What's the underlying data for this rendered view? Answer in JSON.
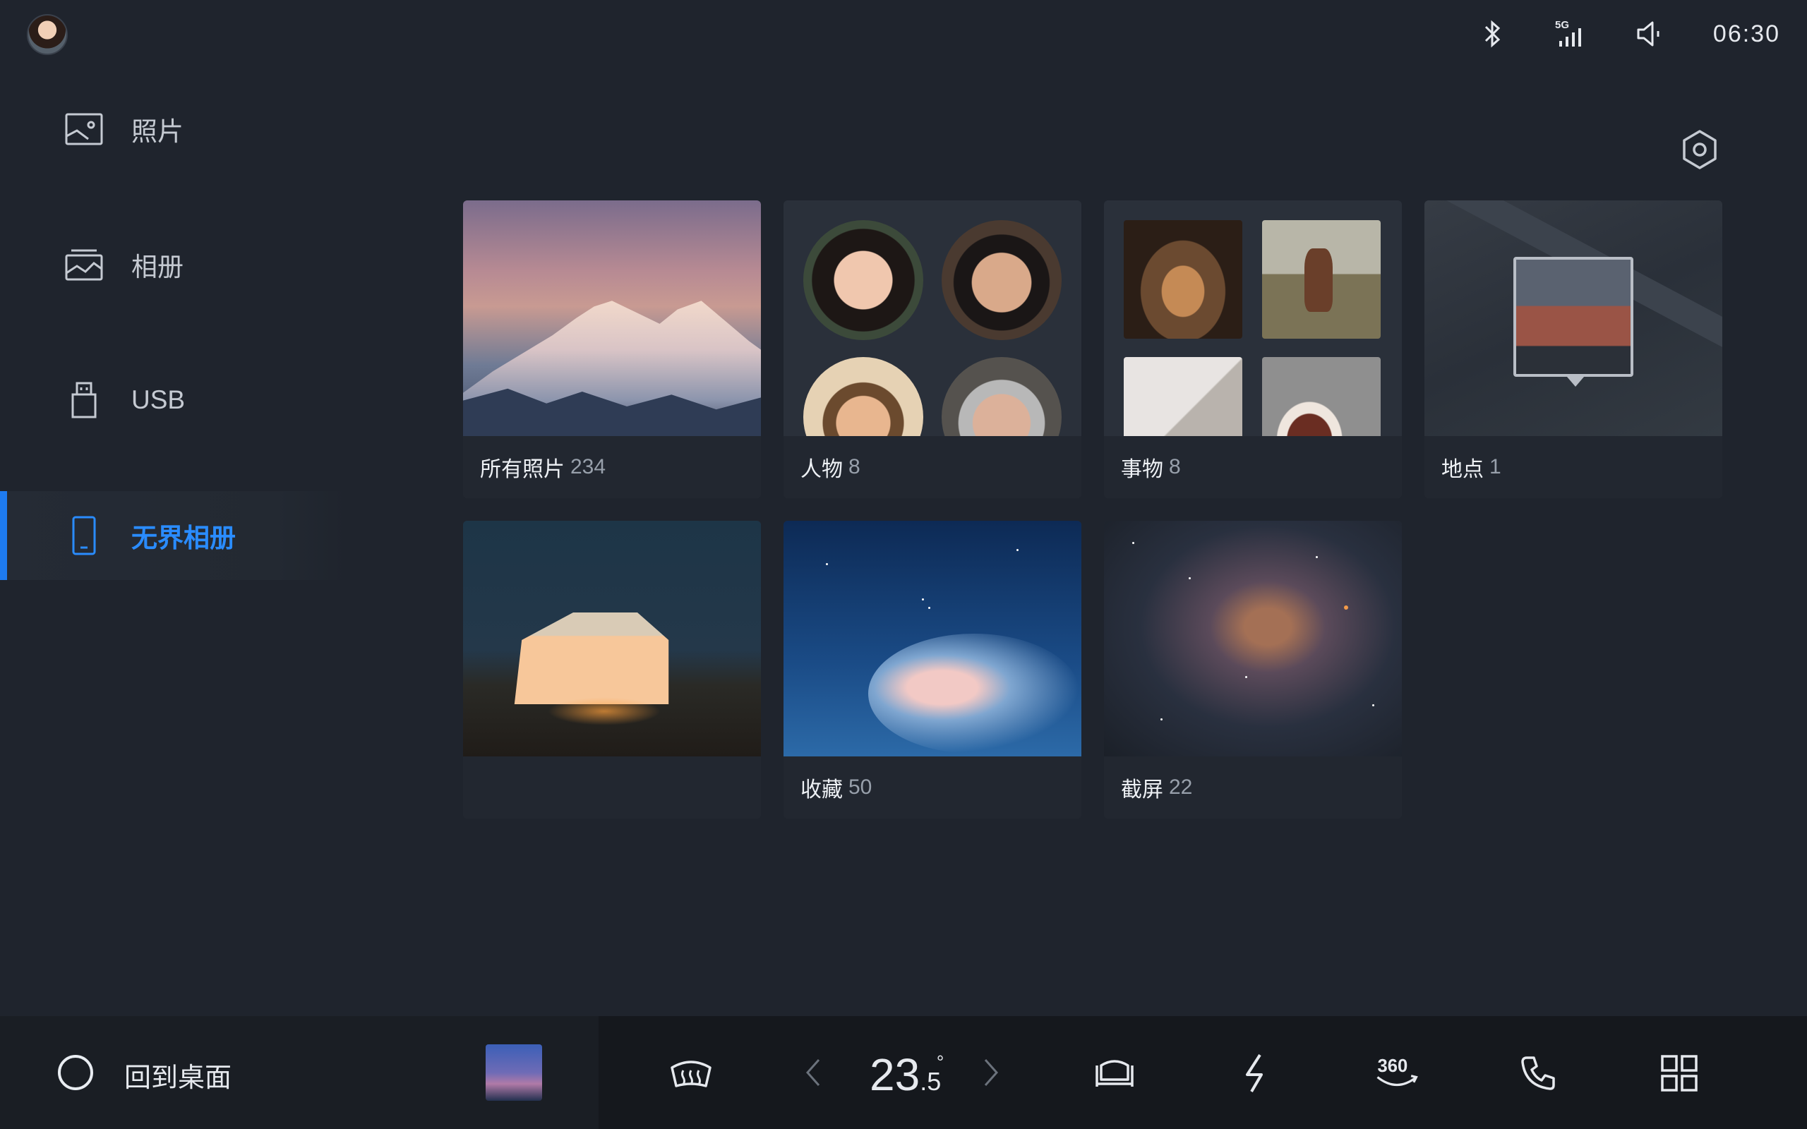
{
  "status_bar": {
    "clock": "06:30",
    "network_label": "5G",
    "icons": [
      "bluetooth-icon",
      "signal-icon",
      "volume-icon"
    ]
  },
  "sidebar": {
    "items": [
      {
        "label": "照片",
        "icon": "photo-icon",
        "active": false
      },
      {
        "label": "相册",
        "icon": "album-icon",
        "active": false
      },
      {
        "label": "USB",
        "icon": "usb-icon",
        "active": false
      },
      {
        "label": "无界相册",
        "icon": "phone-icon",
        "active": true
      }
    ],
    "accent_color": "#1e7bf0"
  },
  "albums": [
    {
      "name": "所有照片",
      "count": "234"
    },
    {
      "name": "人物",
      "count": "8"
    },
    {
      "name": "事物",
      "count": "8"
    },
    {
      "name": "地点",
      "count": "1"
    },
    {
      "name": "",
      "count": ""
    },
    {
      "name": "收藏",
      "count": "50"
    },
    {
      "name": "截屏",
      "count": "22"
    }
  ],
  "dock": {
    "home_label": "回到桌面",
    "temperature_main": "23",
    "temperature_decimal": ".5",
    "temperature_unit": "°",
    "icons": [
      "defrost-icon",
      "seat-icon",
      "flash-icon",
      "camera-360-icon",
      "phone-call-icon",
      "apps-grid-icon"
    ],
    "camera_label": "360"
  }
}
